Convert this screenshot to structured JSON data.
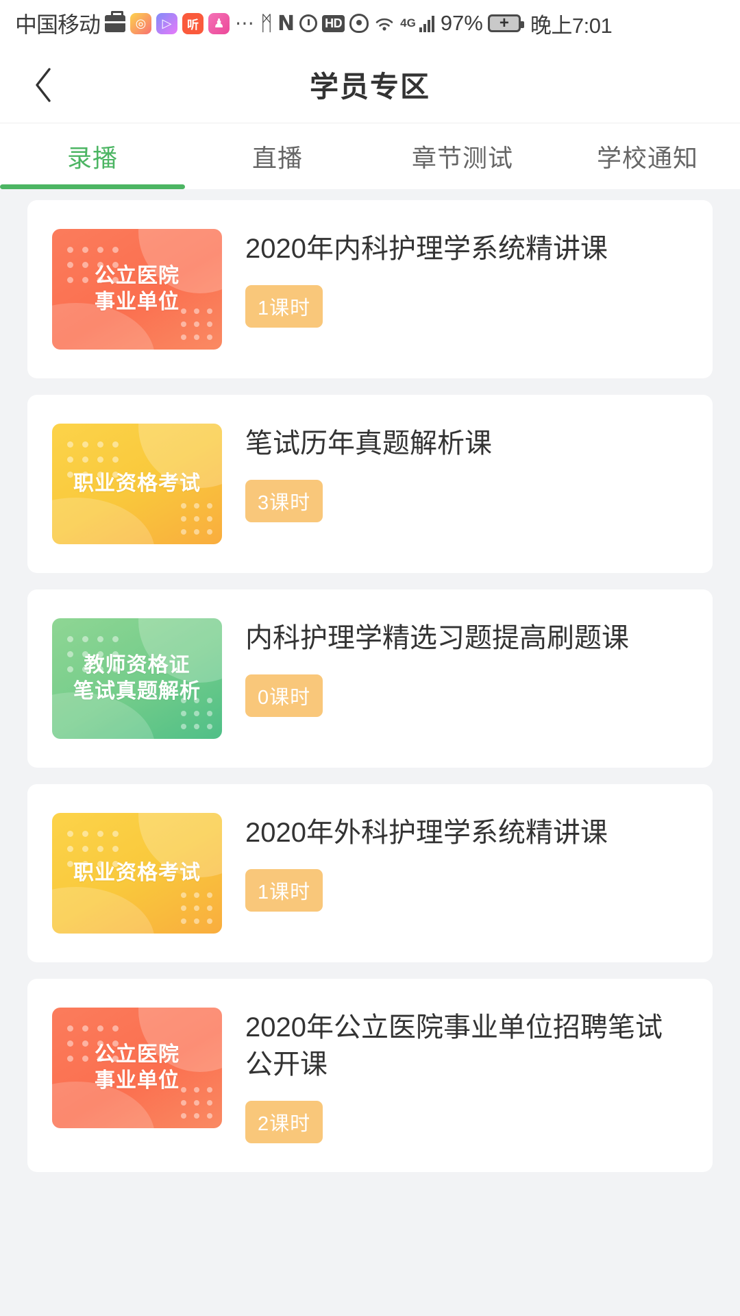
{
  "statusbar": {
    "carrier": "中国移动",
    "icons": [
      "briefcase-icon",
      "weibo-icon",
      "video-play-icon",
      "listen-icon",
      "girl-app-icon",
      "more-dots-icon",
      "bluetooth-icon",
      "nfc-icon",
      "alarm-icon",
      "hd-icon",
      "eye-icon",
      "wifi-icon",
      "4g-icon",
      "signal-bars-icon"
    ],
    "dots": "⋯",
    "bluetooth_glyph": "ᛗ",
    "nfc_glyph": "N",
    "hd_label": "HD",
    "wifi_glyph": "◠",
    "net_type": "4G",
    "battery_percent": "97%",
    "battery_charging_glyph": "+",
    "time": "晚上7:01",
    "app_labels": {
      "weibo": "◎",
      "play": "▷",
      "ting": "听",
      "girl": "♟"
    }
  },
  "header": {
    "title": "学员专区",
    "back_icon": "chevron-left-icon"
  },
  "tabs": {
    "active_index": 0,
    "accent_color": "#4cb563",
    "items": [
      {
        "label": "录播"
      },
      {
        "label": "直播"
      },
      {
        "label": "章节测试"
      },
      {
        "label": "学校通知"
      }
    ]
  },
  "courses": [
    {
      "title": "2020年内科护理学系统精讲课",
      "badge": "1课时",
      "thumb_line1": "公立医院",
      "thumb_line2": "事业单位",
      "thumb_theme": "orange",
      "thumb_color": "#fb7050"
    },
    {
      "title": "笔试历年真题解析课",
      "badge": "3课时",
      "thumb_line1": "职业资格考试",
      "thumb_line2": "",
      "thumb_theme": "yellow",
      "thumb_color": "#f9c93c"
    },
    {
      "title": "内科护理学精选习题提高刷题课",
      "badge": "0课时",
      "thumb_line1": "教师资格证",
      "thumb_line2": "笔试真题解析",
      "thumb_theme": "green",
      "thumb_color": "#6ec989"
    },
    {
      "title": "2020年外科护理学系统精讲课",
      "badge": "1课时",
      "thumb_line1": "职业资格考试",
      "thumb_line2": "",
      "thumb_theme": "yellow",
      "thumb_color": "#f9c93c"
    },
    {
      "title": "2020年公立医院事业单位招聘笔试公开课",
      "badge": "2课时",
      "thumb_line1": "公立医院",
      "thumb_line2": "事业单位",
      "thumb_theme": "orange",
      "thumb_color": "#fb7050"
    }
  ]
}
